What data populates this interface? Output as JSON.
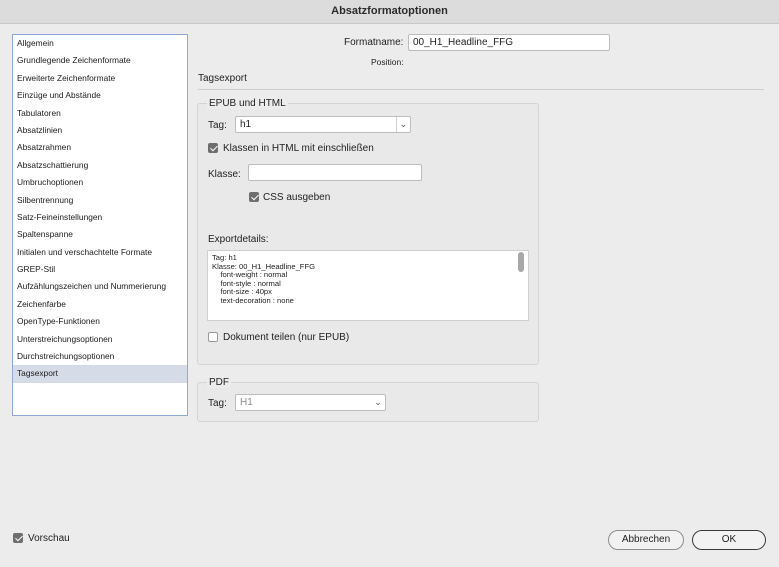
{
  "window": {
    "title": "Absatzformatoptionen"
  },
  "sidebar": {
    "items": [
      {
        "label": "Allgemein"
      },
      {
        "label": "Grundlegende Zeichenformate"
      },
      {
        "label": "Erweiterte Zeichenformate"
      },
      {
        "label": "Einzüge und Abstände"
      },
      {
        "label": "Tabulatoren"
      },
      {
        "label": "Absatzlinien"
      },
      {
        "label": "Absatzrahmen"
      },
      {
        "label": "Absatzschattierung"
      },
      {
        "label": "Umbruchoptionen"
      },
      {
        "label": "Silbentrennung"
      },
      {
        "label": "Satz-Feineinstellungen"
      },
      {
        "label": "Spaltenspanne"
      },
      {
        "label": "Initialen und verschachtelte Formate"
      },
      {
        "label": "GREP-Stil"
      },
      {
        "label": "Aufzählungszeichen und Nummerierung"
      },
      {
        "label": "Zeichenfarbe"
      },
      {
        "label": "OpenType-Funktionen"
      },
      {
        "label": "Unterstreichungsoptionen"
      },
      {
        "label": "Durchstreichungsoptionen"
      },
      {
        "label": "Tagsexport"
      }
    ],
    "selected": "Tagsexport"
  },
  "form": {
    "formatname_label": "Formatname:",
    "formatname_value": "00_H1_Headline_FFG",
    "position_label": "Position:",
    "section_title": "Tagsexport"
  },
  "epub": {
    "title": "EPUB und HTML",
    "tag_label": "Tag:",
    "tag_value": "h1",
    "include_classes_label": "Klassen in HTML mit einschließen",
    "include_classes_checked": true,
    "class_label": "Klasse:",
    "class_value": "",
    "css_label": "CSS ausgeben",
    "css_checked": true,
    "export_details_label": "Exportdetails:",
    "export_details_lines": [
      "Tag: h1",
      "Klasse: 00_H1_Headline_FFG",
      "    font-weight : normal",
      "    font-style : normal",
      "    font-size : 40px",
      "    text-decoration : none"
    ],
    "split_doc_label": "Dokument teilen (nur EPUB)",
    "split_doc_checked": false
  },
  "pdf": {
    "title": "PDF",
    "tag_label": "Tag:",
    "tag_value": "H1"
  },
  "footer": {
    "preview_label": "Vorschau",
    "preview_checked": true,
    "cancel_label": "Abbrechen",
    "ok_label": "OK"
  },
  "icons": {
    "chevron": "chevron-down-icon",
    "check": "checkmark-icon"
  }
}
